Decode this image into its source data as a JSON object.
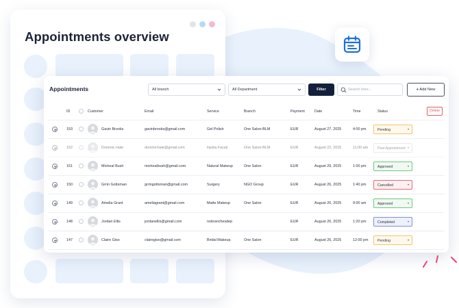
{
  "colors": {
    "blob": "#e9f2fc",
    "placeholder": "#e8f1fc",
    "accent_blue": "#1d6fe0",
    "dark_button": "#14203b",
    "danger": "#e35b66",
    "dot_gray": "#e2e4ea",
    "dot_blue": "#b9d8f6",
    "dot_pink": "#f7b8cd",
    "spark_pink": "#ee3c78"
  },
  "back_card": {
    "title": "Appointments overview"
  },
  "icons": {
    "calendar": "calendar-icon",
    "search": "search-icon",
    "add": "plus-icon",
    "expand": "plus-circle-icon",
    "dropdown": "chevron-down-icon"
  },
  "panel": {
    "title": "Appointments",
    "branch_select": "All branch",
    "department_select": "All Department",
    "filter_label": "Filter",
    "search_placeholder": "Search here...",
    "add_new_label": "Add New",
    "delete_label": "Delete"
  },
  "table": {
    "columns": {
      "id": "ID",
      "customer": "Customer",
      "email": "Email",
      "service": "Service",
      "branch": "Branch",
      "payment": "Payment",
      "date": "Date",
      "time": "Time",
      "status": "Status"
    },
    "rows": [
      {
        "id": "153",
        "customer": "Gavin Brooks",
        "email": "gavinbrooks@gmail.com",
        "service": "Gel Polish",
        "branch": "One Salon-BLM",
        "payment": "EUR",
        "date": "August 27, 2025",
        "time": "4:00 pm",
        "status": "Pending",
        "dim": false
      },
      {
        "id": "152",
        "customer": "Dominic Hale",
        "email": "dominichale@gmail.com",
        "service": "Hydra Facial",
        "branch": "One Salon-BLM",
        "payment": "EUR",
        "date": "August 22, 2025",
        "time": "11:00 am",
        "status": "Past Appointment",
        "dim": true
      },
      {
        "id": "151",
        "customer": "Micheal Bush",
        "email": "michealbush@gmail.com",
        "service": "Natural Makeup",
        "branch": "One Salon",
        "payment": "EUR",
        "date": "August 29, 2025",
        "time": "1:00 pm",
        "status": "Approved",
        "dim": false
      },
      {
        "id": "150",
        "customer": "Grrin Gottsman",
        "email": "grringottsman@gmail.com",
        "service": "Surgery",
        "branch": "NGO Group",
        "payment": "EUR",
        "date": "August 26, 2025",
        "time": "1:40 pm",
        "status": "Cancelled",
        "dim": false
      },
      {
        "id": "149",
        "customer": "Amelia Grant",
        "email": "ameliagrant@gmail.com",
        "service": "Matte Makeup",
        "branch": "One Salon",
        "payment": "EUR",
        "date": "August 26, 2025",
        "time": "9:00 am",
        "status": "Approved",
        "dim": false
      },
      {
        "id": "148",
        "customer": "Jordan Ellis",
        "email": "jordanellis@gmail.com",
        "service": "nobranchesdep",
        "branch": "",
        "payment": "EUR",
        "date": "August 26, 2025",
        "time": "1:20 pm",
        "status": "Completed",
        "dim": false
      },
      {
        "id": "147",
        "customer": "Claire Giso",
        "email": "clairegiso@gmail.com",
        "service": "Bridal Makeup",
        "branch": "One Salon",
        "payment": "EUR",
        "date": "August 26, 2025",
        "time": "12:00 pm",
        "status": "Pending",
        "dim": false
      }
    ]
  },
  "status_styles": {
    "Pending": {
      "border": "#f0c567",
      "bg": "#fff9ec",
      "text": "#3a3a3a"
    },
    "Past Appointment": {
      "border": "#d5d8de",
      "bg": "#ffffff",
      "text": "#555b66"
    },
    "Approved": {
      "border": "#6cc77d",
      "bg": "#f0faf1",
      "text": "#2b3040"
    },
    "Cancelled": {
      "border": "#e86b74",
      "bg": "#fdf0f1",
      "text": "#2b3040"
    },
    "Completed": {
      "border": "#7f8fd3",
      "bg": "#eef1fb",
      "text": "#2b3040"
    }
  }
}
